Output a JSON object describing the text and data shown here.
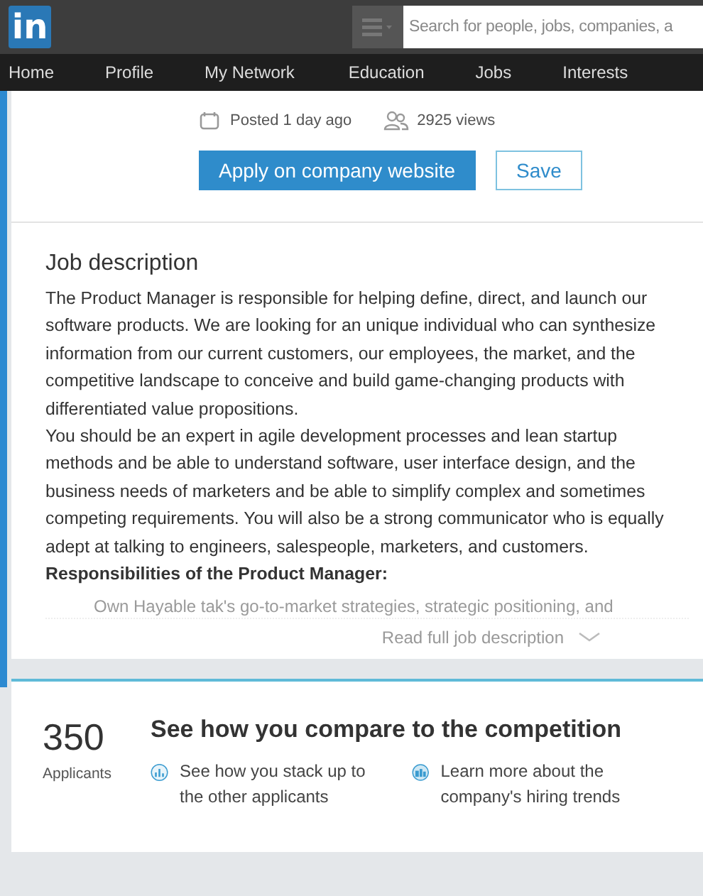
{
  "header": {
    "logo": "in",
    "search": {
      "placeholder": "Search for people, jobs, companies, a"
    }
  },
  "nav": [
    {
      "label": "Home"
    },
    {
      "label": "Profile"
    },
    {
      "label": "My Network"
    },
    {
      "label": "Education"
    },
    {
      "label": "Jobs"
    },
    {
      "label": "Interests"
    }
  ],
  "meta": {
    "posted": "Posted 1 day ago",
    "views": "2925 views"
  },
  "actions": {
    "apply": "Apply on company website",
    "save": "Save"
  },
  "job_description": {
    "title": "Job description",
    "paragraphs": [
      "The Product Manager is responsible for helping define, direct, and launch our software products. We are looking for an unique individual who can synthesize information from our current customers, our employees, the market, and the competitive landscape to conceive and build game-changing products with differentiated value propositions.",
      "You should be an expert in agile development processes and lean startup methods and be able to understand software, user interface design, and the business needs of marketers and be able to simplify complex and sometimes competing requirements. You will also be a strong communicator who is equally adept at talking to engineers, salespeople, marketers, and customers."
    ],
    "subheading": "Responsibilities of the Product Manager:",
    "faded_bullet": "Own Hayable tak's go-to-market strategies, strategic positioning, and",
    "read_more": "Read full job description"
  },
  "competition": {
    "count": "350",
    "count_label": "Applicants",
    "title": "See how you compare to the competition",
    "items": [
      {
        "kind": "stack",
        "text": "See how you stack up to the other applicants"
      },
      {
        "kind": "trends",
        "text": "Learn more about the company's hiring trends"
      }
    ]
  }
}
